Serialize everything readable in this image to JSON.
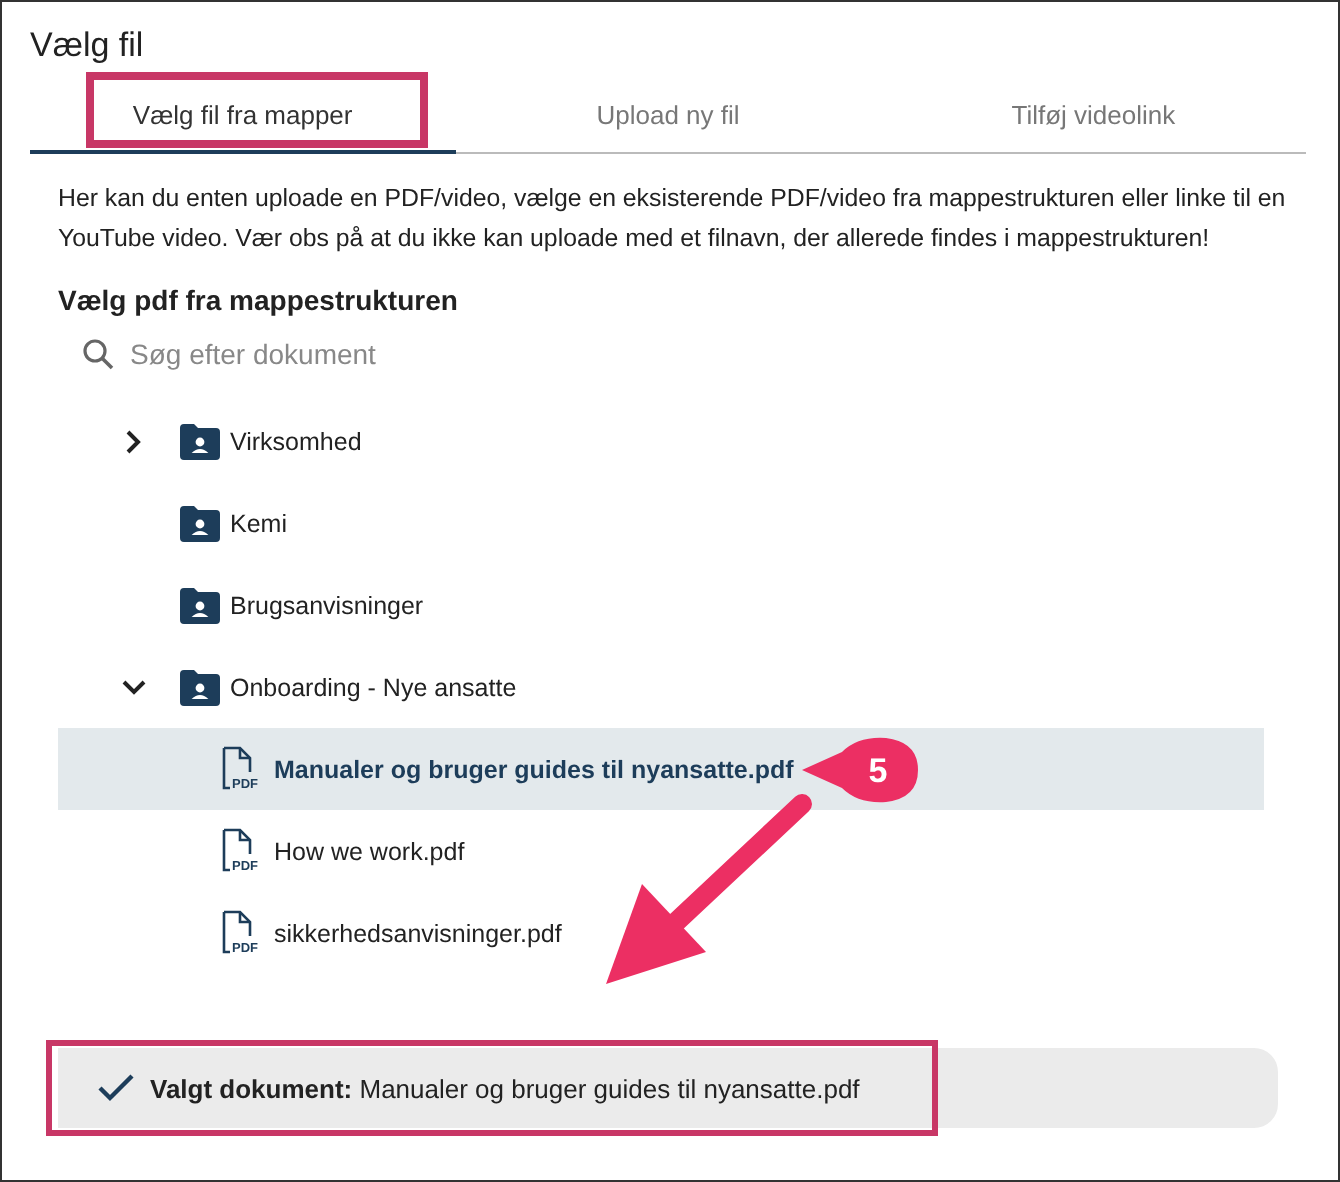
{
  "title": "Vælg fil",
  "tabs": [
    {
      "label": "Vælg fil fra mapper",
      "selected": true,
      "highlighted": true
    },
    {
      "label": "Upload ny fil",
      "selected": false,
      "highlighted": false
    },
    {
      "label": "Tilføj videolink",
      "selected": false,
      "highlighted": false
    }
  ],
  "intro": "Her kan du enten uploade en PDF/video, vælge en eksisterende PDF/video fra mappestrukturen eller linke til en YouTube video. Vær obs på at du ikke kan uploade med et filnavn, der allerede findes i mappestrukturen!",
  "tree_heading": "Vælg pdf fra mappestrukturen",
  "search": {
    "placeholder": "Søg efter dokument"
  },
  "tree": [
    {
      "kind": "expandable_folder",
      "label": "Virksomhed",
      "expanded": false
    },
    {
      "kind": "folder",
      "label": "Kemi"
    },
    {
      "kind": "folder",
      "label": "Brugsanvisninger"
    },
    {
      "kind": "expandable_folder",
      "label": "Onboarding - Nye ansatte",
      "expanded": true,
      "children": [
        {
          "kind": "file",
          "label": "Manualer og bruger guides til nyansatte.pdf",
          "icon_label": "PDF",
          "selected": true,
          "callout": "5"
        },
        {
          "kind": "file",
          "label": "How we work.pdf",
          "icon_label": "PDF",
          "selected": false
        },
        {
          "kind": "file",
          "label": "sikkerhedsanvisninger.pdf",
          "icon_label": "PDF",
          "selected": false
        }
      ]
    }
  ],
  "selection": {
    "text": "**Valgt dokument:** Manualer og bruger guides til nyansatte.pdf",
    "highlighted": true,
    "arrow": true
  }
}
